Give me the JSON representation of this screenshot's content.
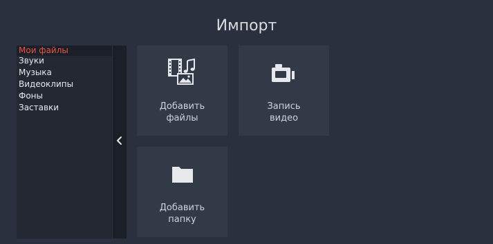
{
  "header": {
    "title": "Импорт"
  },
  "sidebar": {
    "items": [
      {
        "label": "Мои файлы",
        "active": true
      },
      {
        "label": "Звуки"
      },
      {
        "label": "Музыка"
      },
      {
        "label": "Видеоклипы"
      },
      {
        "label": "Фоны"
      },
      {
        "label": "Заставки"
      }
    ]
  },
  "tiles": {
    "add_files": {
      "line1": "Добавить",
      "line2": "файлы",
      "icon": "media-files-icon"
    },
    "record_video": {
      "line1": "Запись",
      "line2": "видео",
      "icon": "camcorder-icon"
    },
    "add_folder": {
      "line1": "Добавить",
      "line2": "папку",
      "icon": "folder-icon"
    }
  },
  "colors": {
    "background": "#2a303d",
    "sidebar": "#232833",
    "tile": "#323947",
    "accent": "#e8553e"
  }
}
